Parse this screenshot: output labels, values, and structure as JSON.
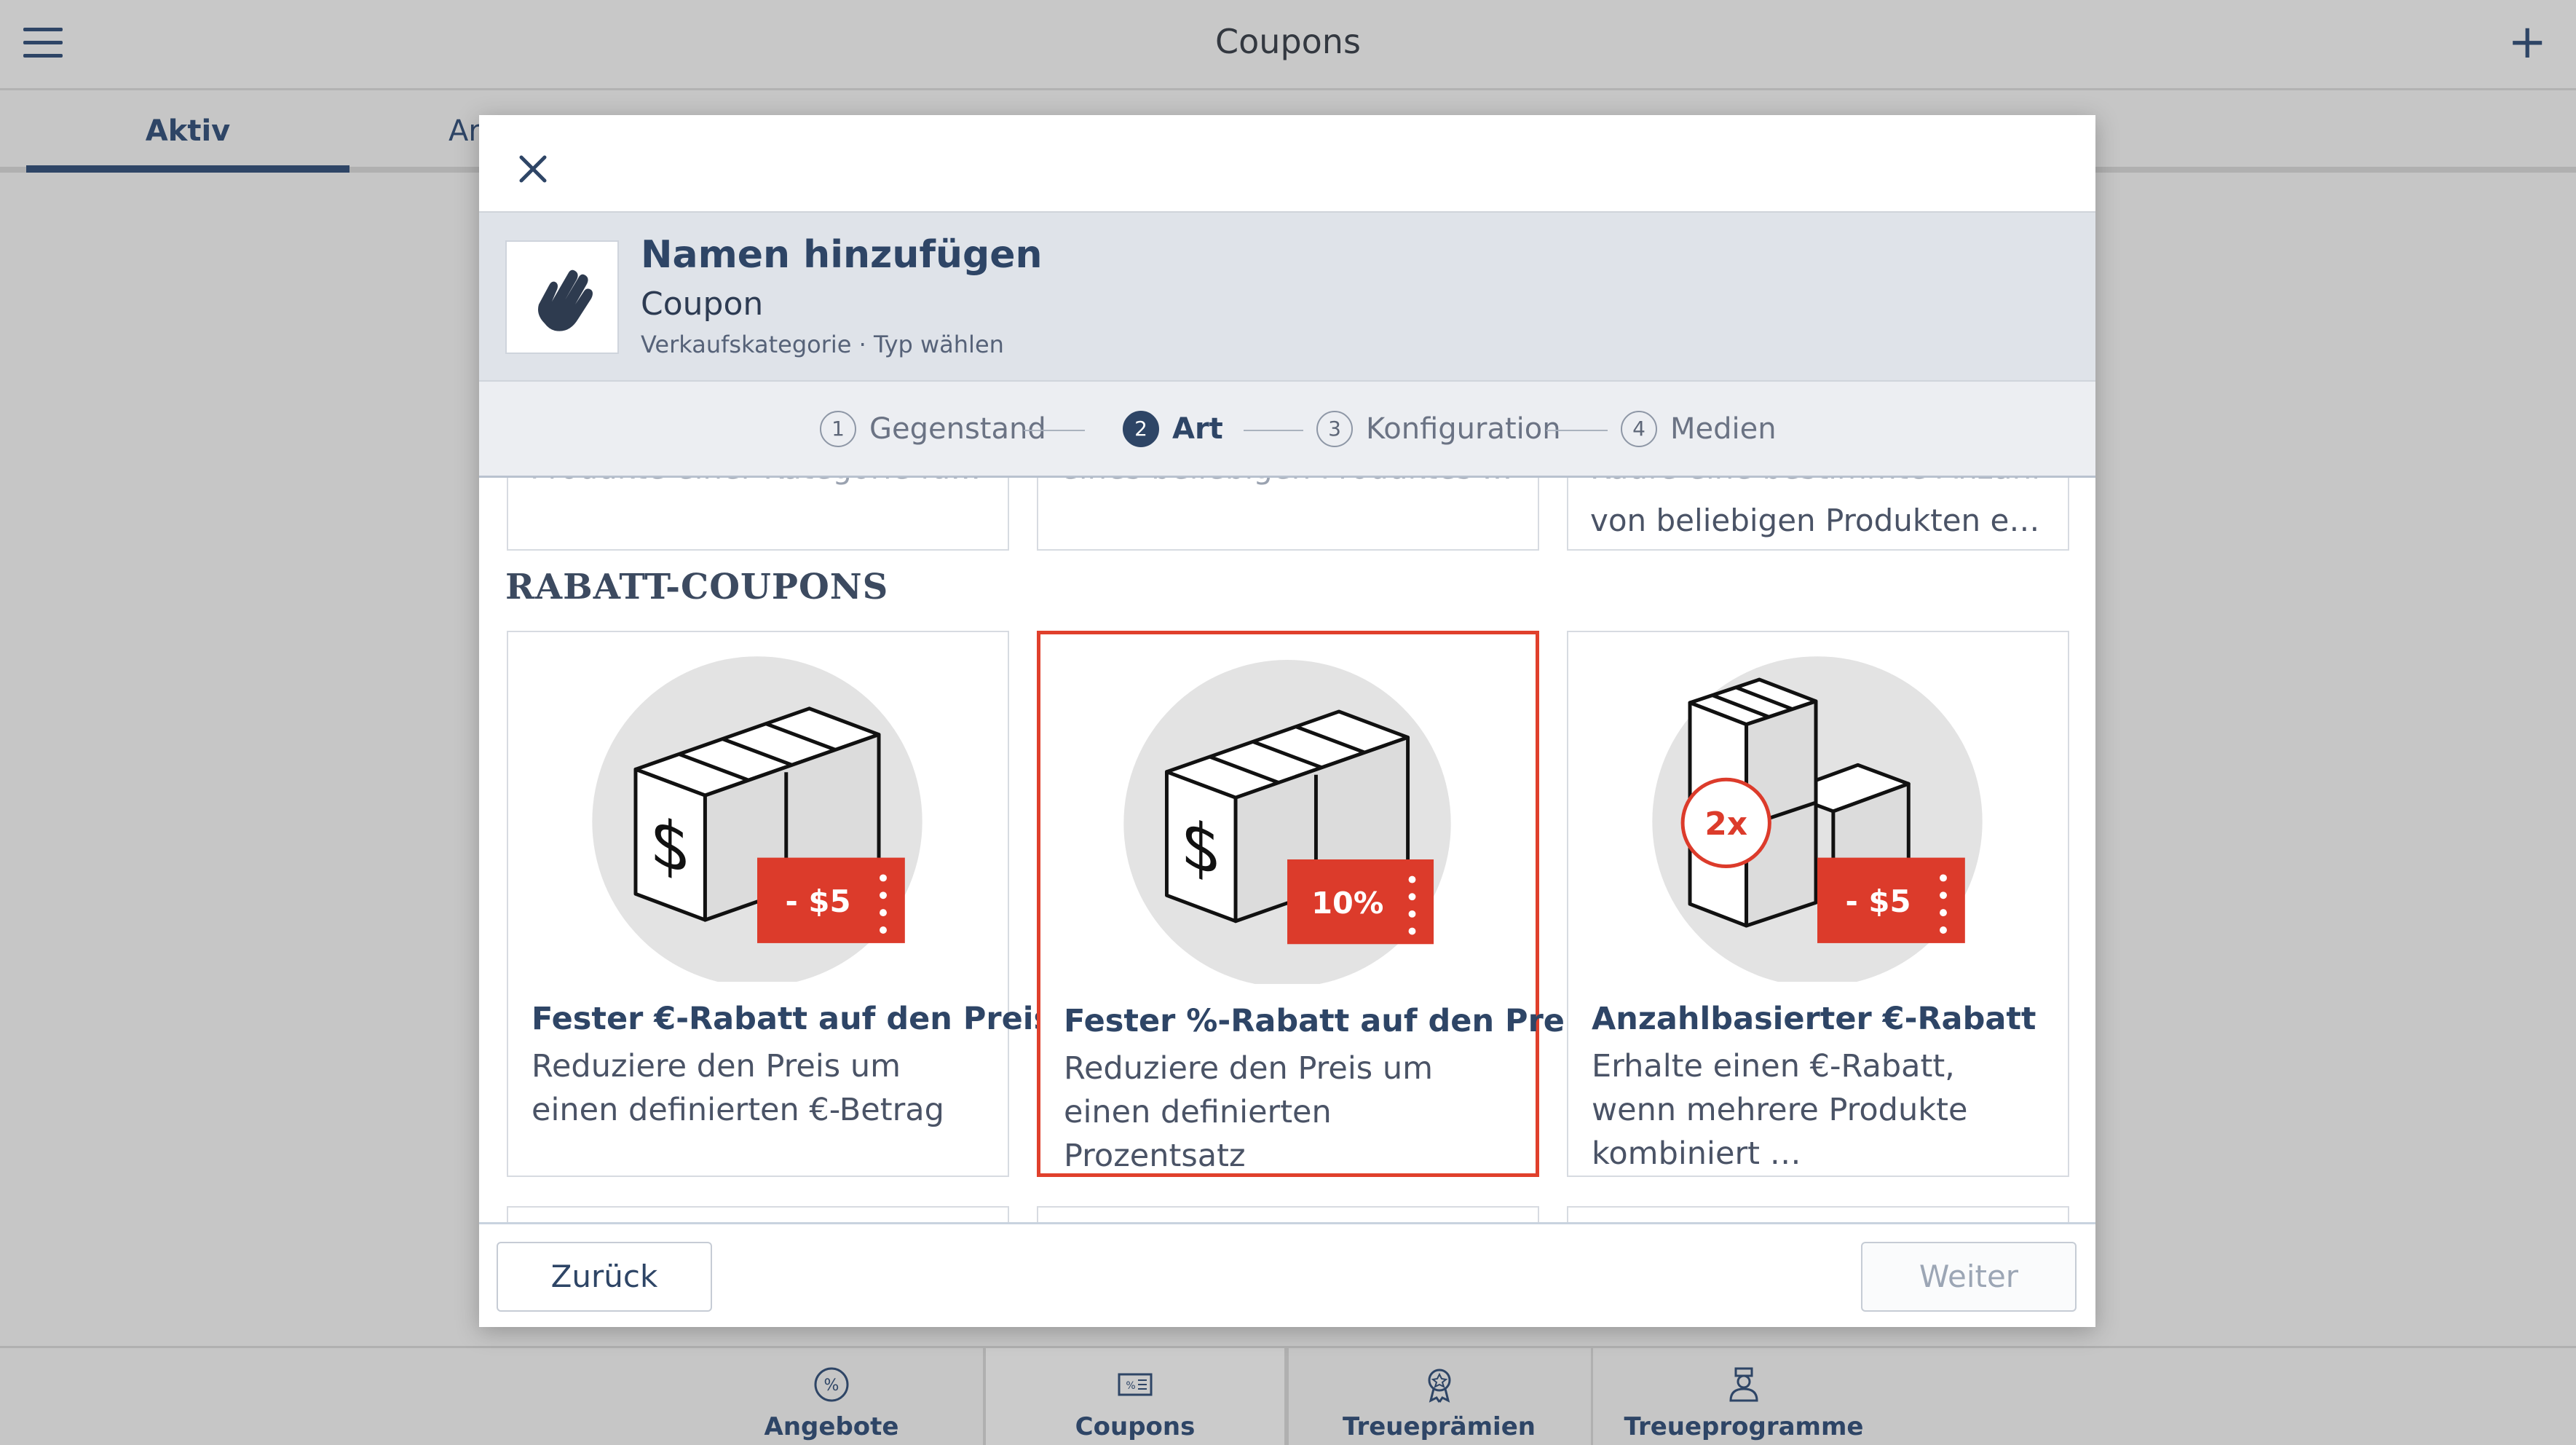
{
  "app": {
    "title": "Coupons",
    "add_symbol": "+"
  },
  "tabs": [
    {
      "label": "Aktiv"
    },
    {
      "label": "Ar"
    }
  ],
  "bottom_nav": [
    {
      "label": "Angebote",
      "icon": "percent-badge-icon"
    },
    {
      "label": "Coupons",
      "icon": "coupon-ticket-icon"
    },
    {
      "label": "Treueprämien",
      "icon": "award-ribbon-icon"
    },
    {
      "label": "Treueprogramme",
      "icon": "user-badge-icon"
    }
  ],
  "modal": {
    "header": {
      "title": "Namen hinzufügen",
      "subtitle": "Coupon",
      "meta": "Verkaufskategorie · Typ wählen",
      "icon": "hand-icon"
    },
    "steps": [
      {
        "num": "1",
        "label": "Gegenstand"
      },
      {
        "num": "2",
        "label": "Art"
      },
      {
        "num": "3",
        "label": "Konfiguration"
      },
      {
        "num": "4",
        "label": "Medien"
      }
    ],
    "top_cards": [
      {
        "faded": "Produkte einer Kategorie für ein…",
        "desc": ""
      },
      {
        "faded": "eines beliebigen Produktes ein…",
        "desc": ""
      },
      {
        "faded": "Kaufe eine bestimmte Anzahl",
        "desc": "von beliebigen Produkten eine…"
      }
    ],
    "section_title": "RABATT-COUPONS",
    "cards": [
      {
        "title": "Fester €-Rabatt auf den Preis",
        "desc": "Reduziere den Preis um einen definierten €-Betrag",
        "tag": "- $5",
        "selected": false
      },
      {
        "title": "Fester %-Rabatt auf den Preis",
        "desc": "Reduziere den Preis um einen definierten Prozentsatz",
        "tag": "10%",
        "selected": true
      },
      {
        "title": "Anzahlbasierter €-Rabatt",
        "desc": "Erhalte einen €-Rabatt, wenn mehrere Produkte kombiniert …",
        "tag": "- $5",
        "badge": "2x",
        "selected": false
      }
    ],
    "footer": {
      "back_label": "Zurück",
      "next_label": "Weiter"
    }
  },
  "colors": {
    "accent": "#e0402c",
    "primary": "#2e4566",
    "overlay_bg": "#c6c6c6"
  }
}
